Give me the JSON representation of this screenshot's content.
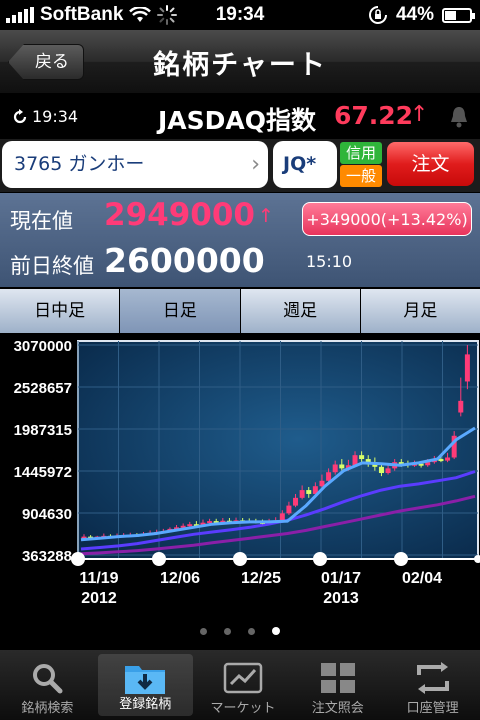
{
  "status_bar": {
    "carrier": "SoftBank",
    "time": "19:34",
    "battery": "44%"
  },
  "nav": {
    "back_label": "戻る",
    "title": "銘柄チャート"
  },
  "index_bar": {
    "time": "19:34",
    "name": "JASDAQ指数",
    "value": "67.22",
    "arrow": "↑"
  },
  "stock": {
    "name": "3765 ガンホー",
    "market": "JQ*",
    "shinyo": "信用",
    "ippan": "一般",
    "order_label": "注文"
  },
  "price": {
    "current_label": "現在値",
    "current": "2949000",
    "arrow": "↑",
    "change": "+349000(+13.42%)",
    "prev_label": "前日終値",
    "prev": "2600000",
    "time": "15:10"
  },
  "tabs": [
    {
      "label": "日中足"
    },
    {
      "label": "日足"
    },
    {
      "label": "週足"
    },
    {
      "label": "月足"
    }
  ],
  "active_tab": 1,
  "chart_data": {
    "type": "candlestick",
    "y_ticks": [
      "3070000",
      "2528657",
      "1987315",
      "1445972",
      "904630",
      "363288"
    ],
    "ylim": [
      363288,
      3070000
    ],
    "x_ticks": [
      {
        "label": "11/19",
        "sub": "2012"
      },
      {
        "label": "12/06",
        "sub": ""
      },
      {
        "label": "12/25",
        "sub": ""
      },
      {
        "label": "01/17",
        "sub": "2013"
      },
      {
        "label": "02/04",
        "sub": ""
      }
    ],
    "candles": [
      [
        590000,
        600000,
        630000,
        580000
      ],
      [
        600000,
        590000,
        620000,
        570000
      ],
      [
        590000,
        600000,
        610000,
        575000
      ],
      [
        600000,
        610000,
        640000,
        590000
      ],
      [
        610000,
        605000,
        630000,
        590000
      ],
      [
        605000,
        615000,
        640000,
        595000
      ],
      [
        615000,
        620000,
        645000,
        600000
      ],
      [
        620000,
        625000,
        650000,
        605000
      ],
      [
        625000,
        615000,
        645000,
        600000
      ],
      [
        615000,
        640000,
        660000,
        610000
      ],
      [
        640000,
        650000,
        680000,
        630000
      ],
      [
        650000,
        660000,
        690000,
        640000
      ],
      [
        660000,
        670000,
        700000,
        650000
      ],
      [
        670000,
        700000,
        720000,
        660000
      ],
      [
        700000,
        720000,
        750000,
        690000
      ],
      [
        720000,
        740000,
        770000,
        710000
      ],
      [
        740000,
        760000,
        790000,
        730000
      ],
      [
        760000,
        750000,
        800000,
        740000
      ],
      [
        750000,
        780000,
        820000,
        740000
      ],
      [
        780000,
        800000,
        830000,
        770000
      ],
      [
        800000,
        790000,
        830000,
        780000
      ],
      [
        790000,
        805000,
        840000,
        780000
      ],
      [
        805000,
        800000,
        840000,
        785000
      ],
      [
        800000,
        810000,
        845000,
        790000
      ],
      [
        810000,
        805000,
        840000,
        790000
      ],
      [
        805000,
        800000,
        835000,
        780000
      ],
      [
        800000,
        790000,
        830000,
        770000
      ],
      [
        790000,
        780000,
        820000,
        760000
      ],
      [
        780000,
        800000,
        830000,
        770000
      ],
      [
        800000,
        810000,
        850000,
        790000
      ],
      [
        810000,
        900000,
        940000,
        800000
      ],
      [
        900000,
        1000000,
        1050000,
        880000
      ],
      [
        1000000,
        1100000,
        1150000,
        980000
      ],
      [
        1100000,
        1200000,
        1260000,
        1080000
      ],
      [
        1200000,
        1150000,
        1240000,
        1100000
      ],
      [
        1150000,
        1250000,
        1300000,
        1130000
      ],
      [
        1250000,
        1320000,
        1400000,
        1230000
      ],
      [
        1320000,
        1430000,
        1480000,
        1300000
      ],
      [
        1430000,
        1530000,
        1580000,
        1400000
      ],
      [
        1530000,
        1480000,
        1600000,
        1450000
      ],
      [
        1480000,
        1520000,
        1590000,
        1450000
      ],
      [
        1520000,
        1650000,
        1700000,
        1500000
      ],
      [
        1650000,
        1600000,
        1700000,
        1550000
      ],
      [
        1600000,
        1560000,
        1650000,
        1500000
      ],
      [
        1560000,
        1500000,
        1620000,
        1450000
      ],
      [
        1500000,
        1420000,
        1540000,
        1380000
      ],
      [
        1420000,
        1480000,
        1520000,
        1400000
      ],
      [
        1480000,
        1560000,
        1600000,
        1450000
      ],
      [
        1560000,
        1550000,
        1600000,
        1500000
      ],
      [
        1550000,
        1520000,
        1580000,
        1490000
      ],
      [
        1520000,
        1540000,
        1580000,
        1500000
      ],
      [
        1540000,
        1520000,
        1560000,
        1490000
      ],
      [
        1520000,
        1560000,
        1600000,
        1500000
      ],
      [
        1560000,
        1600000,
        1640000,
        1540000
      ],
      [
        1600000,
        1580000,
        1640000,
        1560000
      ],
      [
        1580000,
        1620000,
        1680000,
        1560000
      ],
      [
        1620000,
        1900000,
        1960000,
        1600000
      ],
      [
        2200000,
        2350000,
        2650000,
        2150000
      ],
      [
        2600000,
        2949000,
        3070000,
        2500000
      ]
    ],
    "ma_short": [
      560000,
      580000,
      600000,
      615000,
      640000,
      680000,
      720000,
      760000,
      780000,
      790000,
      790000,
      800000,
      1000000,
      1250000,
      1450000,
      1550000,
      1540000,
      1520000,
      1550000,
      1600000,
      1850000,
      2000000
    ],
    "ma_mid": [
      440000,
      460000,
      480000,
      510000,
      550000,
      590000,
      630000,
      660000,
      690000,
      720000,
      760000,
      810000,
      880000,
      960000,
      1050000,
      1130000,
      1200000,
      1250000,
      1280000,
      1320000,
      1360000,
      1440000
    ],
    "ma_long": [
      380000,
      390000,
      405000,
      420000,
      440000,
      465000,
      490000,
      520000,
      550000,
      580000,
      610000,
      640000,
      680000,
      730000,
      780000,
      830000,
      880000,
      930000,
      970000,
      1010000,
      1060000,
      1120000
    ],
    "colors": {
      "up": "#ff3b78",
      "down": "#d8ff6a",
      "ma_short": "#5aa9ff",
      "ma_mid": "#5a3cff",
      "ma_long": "#8a1fa8"
    }
  },
  "page_dots": {
    "count": 4,
    "active": 3
  },
  "tabbar": [
    {
      "label": "銘柄検索",
      "icon": "search-icon"
    },
    {
      "label": "登録銘柄",
      "icon": "folder-download-icon"
    },
    {
      "label": "マーケット",
      "icon": "line-chart-icon"
    },
    {
      "label": "注文照会",
      "icon": "grid-icon"
    },
    {
      "label": "口座管理",
      "icon": "refresh-arrows-icon"
    }
  ],
  "tabbar_active": 1
}
